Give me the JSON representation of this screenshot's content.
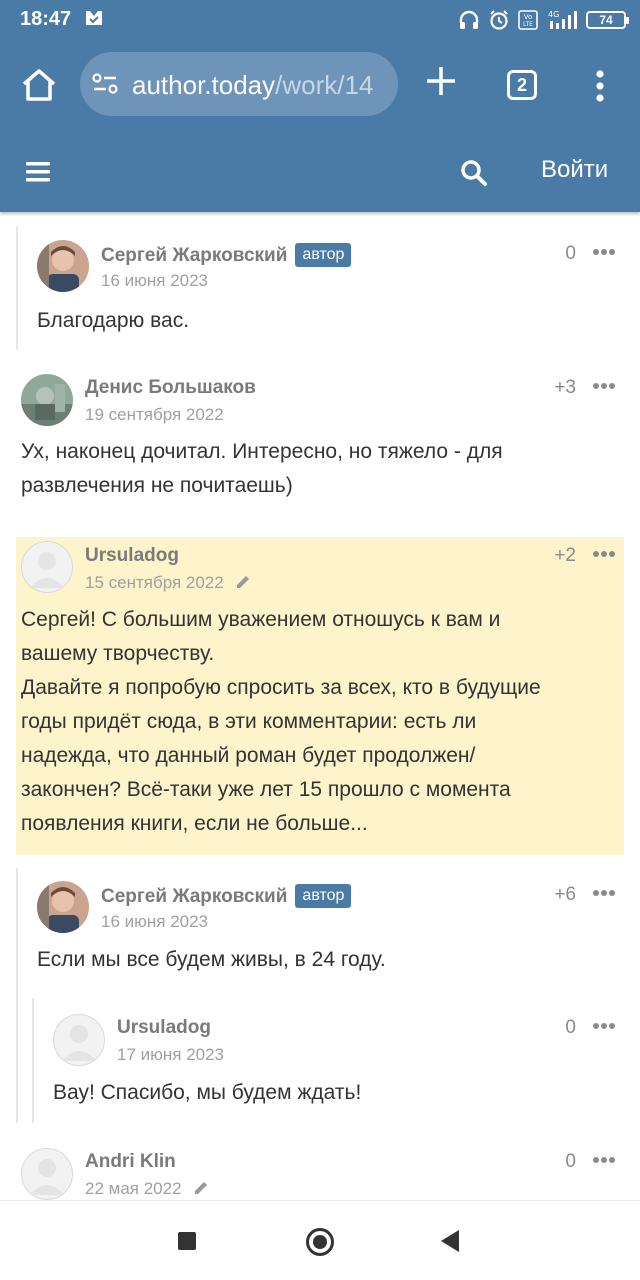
{
  "status": {
    "time": "18:47",
    "battery": "74"
  },
  "browser": {
    "url_host": "author.today",
    "url_path": "/work/14",
    "tab_count": "2"
  },
  "header": {
    "login": "Войти"
  },
  "comments": [
    {
      "author": "Сергей Жарковский",
      "badge": "автор",
      "date": "16 июня 2023",
      "score": "0",
      "text": "Благодарю вас."
    },
    {
      "author": "Денис Большаков",
      "date": "19 сентября 2022",
      "score": "+3",
      "text_lines": [
        "Ух, наконец дочитал. Интересно, но тяжело - для",
        "развлечения не почитаешь)"
      ]
    },
    {
      "author": "Ursuladog",
      "date": "15 сентября 2022",
      "score": "+2",
      "text_lines": [
        "Сергей! С большим уважением отношусь к вам и",
        "вашему творчеству.",
        "Давайте я попробую спросить за всех, кто в будущие",
        "годы придёт сюда, в эти комментарии: есть ли",
        "надежда, что данный роман будет продолжен/",
        "закончен? Всё-таки уже лет 15 прошло с момента",
        "появления книги, если не больше..."
      ]
    },
    {
      "author": "Сергей Жарковский",
      "badge": "автор",
      "date": "16 июня 2023",
      "score": "+6",
      "text": "Если мы все будем живы, в 24 году."
    },
    {
      "author": "Ursuladog",
      "date": "17 июня 2023",
      "score": "0",
      "text": "Вау! Спасибо, мы будем ждать!"
    },
    {
      "author": "Andri Klin",
      "date": "22 мая 2022",
      "score": "0"
    }
  ]
}
